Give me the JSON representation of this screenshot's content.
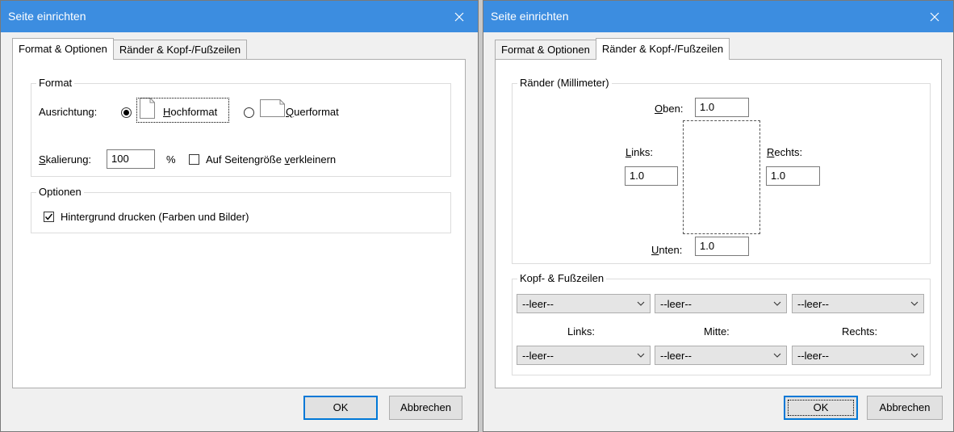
{
  "dialog1": {
    "title": "Seite einrichten",
    "tabs": [
      "Format & Optionen",
      "Ränder & Kopf-/Fußzeilen"
    ],
    "format": {
      "legend": "Format",
      "orientation_label": "Ausrichtung:",
      "portrait": {
        "accel": "H",
        "rest": "ochformat",
        "selected": true
      },
      "landscape": {
        "accel": "Q",
        "rest": "uerformat",
        "selected": false
      },
      "scale_label": {
        "accel": "S",
        "rest": "kalierung:"
      },
      "scale_value": "100",
      "percent": "%",
      "shrink": {
        "pre": "Auf Seitengröße ",
        "accel": "v",
        "post": "erkleinern",
        "checked": false
      }
    },
    "options": {
      "legend": "Optionen",
      "bg": {
        "pre": "Hinter",
        "accel": "g",
        "post": "rund drucken (Farben und Bilder)",
        "checked": true
      }
    },
    "ok": "OK",
    "cancel": "Abbrechen"
  },
  "dialog2": {
    "title": "Seite einrichten",
    "tabs": [
      "Format & Optionen",
      "Ränder & Kopf-/Fußzeilen"
    ],
    "margins": {
      "legend": "Ränder (Millimeter)",
      "top": {
        "accel": "O",
        "rest": "ben:",
        "value": "1.0"
      },
      "left": {
        "accel": "L",
        "rest": "inks:",
        "value": "1.0"
      },
      "right": {
        "accel": "R",
        "rest": "echts:",
        "value": "1.0"
      },
      "bottom": {
        "accel": "U",
        "rest": "nten:",
        "value": "1.0"
      }
    },
    "headers": {
      "legend": "Kopf- & Fußzeilen",
      "header_selects": [
        "--leer--",
        "--leer--",
        "--leer--"
      ],
      "col_labels": [
        "Links:",
        "Mitte:",
        "Rechts:"
      ],
      "footer_selects": [
        "--leer--",
        "--leer--",
        "--leer--"
      ]
    },
    "ok": "OK",
    "cancel": "Abbrechen"
  },
  "colors": {
    "titlebar": "#3c8de0",
    "dialog_bg": "#f0f0f0",
    "focus_border": "#0078d7"
  },
  "icons": [
    "close-icon",
    "page-portrait-icon",
    "page-landscape-icon",
    "chevron-down-icon",
    "checkmark-icon"
  ]
}
